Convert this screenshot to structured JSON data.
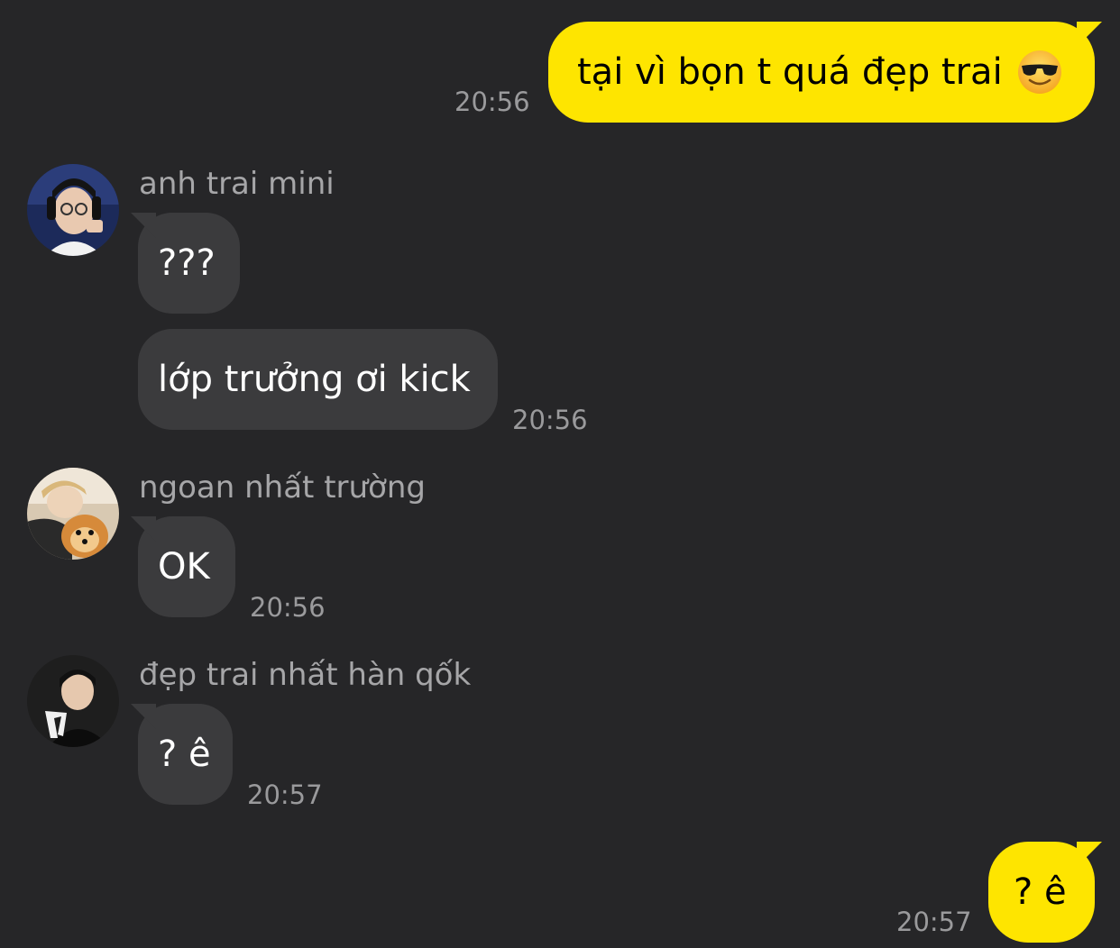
{
  "messages": {
    "out1": {
      "text": "tại vì bọn t quá đẹp trai",
      "emoji": "smiling-face-with-sunglasses",
      "time": "20:56"
    },
    "in1": {
      "sender": "anh trai mini",
      "bubbles": [
        "???",
        "lớp trưởng ơi kick"
      ],
      "time": "20:56"
    },
    "in2": {
      "sender": "ngoan nhất trường",
      "bubbles": [
        "OK"
      ],
      "time": "20:56"
    },
    "in3": {
      "sender": "đẹp trai nhất hàn qốk",
      "bubbles": [
        "? ê"
      ],
      "time": "20:57"
    },
    "out2": {
      "text": "? ê",
      "time": "20:57"
    }
  },
  "colors": {
    "background": "#262628",
    "outgoing_bubble": "#fee500",
    "incoming_bubble": "#3b3b3d",
    "timestamp": "#9a9a9c"
  }
}
